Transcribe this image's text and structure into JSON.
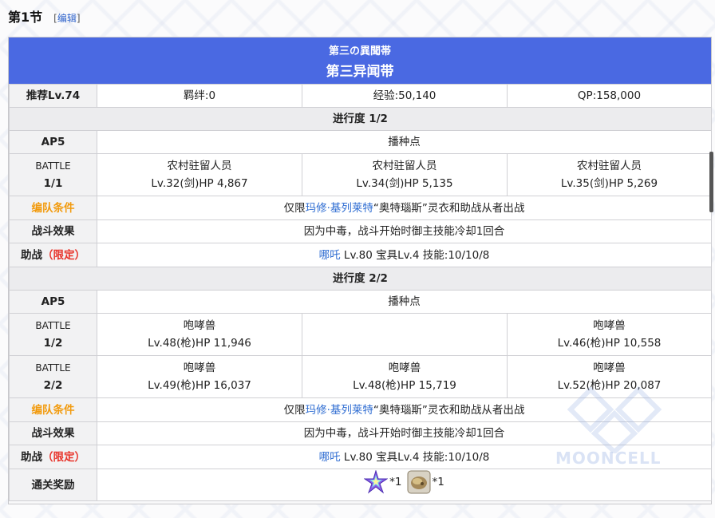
{
  "heading": {
    "title": "第1节",
    "edit_open": "[",
    "edit_label": "编辑",
    "edit_close": "]"
  },
  "banner": {
    "subtitle": "第三の異聞帯",
    "title": "第三异闻带"
  },
  "summary": {
    "level": "推荐Lv.74",
    "bond": "羁绊:0",
    "exp": "经验:50,140",
    "qp": "QP:158,000"
  },
  "progress": [
    {
      "header": "进行度 1/2",
      "ap": "AP5",
      "ap_value": "播种点",
      "battles": [
        {
          "label": "BATTLE",
          "count": "1/1",
          "enemies": [
            {
              "name": "农村驻留人员",
              "stats": "Lv.32(剑)HP 4,867"
            },
            {
              "name": "农村驻留人员",
              "stats": "Lv.34(剑)HP 5,135"
            },
            {
              "name": "农村驻留人员",
              "stats": "Lv.35(剑)HP 5,269"
            }
          ]
        }
      ],
      "formation_label": "编队条件",
      "formation_pre": "仅限",
      "formation_link": "玛修·基列莱特",
      "formation_post": "“奥特瑙斯”灵衣和助战从者出战",
      "effect_label": "战斗效果",
      "effect_text": "因为中毒，战斗开始时御主技能冷却1回合",
      "support_label": "助战",
      "support_tag": "（限定）",
      "support_link": "哪吒",
      "support_text": " Lv.80 宝具Lv.4 技能:10/10/8"
    },
    {
      "header": "进行度 2/2",
      "ap": "AP5",
      "ap_value": "播种点",
      "battles": [
        {
          "label": "BATTLE",
          "count": "1/2",
          "enemies": [
            {
              "name": "咆哮兽",
              "stats": "Lv.48(枪)HP 11,946"
            },
            {
              "name": "",
              "stats": ""
            },
            {
              "name": "咆哮兽",
              "stats": "Lv.46(枪)HP 10,558"
            }
          ]
        },
        {
          "label": "BATTLE",
          "count": "2/2",
          "enemies": [
            {
              "name": "咆哮兽",
              "stats": "Lv.49(枪)HP 16,037"
            },
            {
              "name": "咆哮兽",
              "stats": "Lv.48(枪)HP 15,719"
            },
            {
              "name": "咆哮兽",
              "stats": "Lv.52(枪)HP 20,087"
            }
          ]
        }
      ],
      "formation_label": "编队条件",
      "formation_pre": "仅限",
      "formation_link": "玛修·基列莱特",
      "formation_post": "“奥特瑙斯”灵衣和助战从者出战",
      "effect_label": "战斗效果",
      "effect_text": "因为中毒，战斗开始时御主技能冷却1回合",
      "support_label": "助战",
      "support_tag": "（限定）",
      "support_link": "哪吒",
      "support_text": " Lv.80 宝具Lv.4 技能:10/10/8"
    }
  ],
  "reward": {
    "label": "通关奖励",
    "items": [
      {
        "icon": "saint-quartz-icon",
        "count": "*1"
      },
      {
        "icon": "ascension-material-icon",
        "count": "*1"
      }
    ]
  },
  "watermark": "MOONCELL",
  "colors": {
    "banner": "#4a69e2",
    "orange": "#f29b0e",
    "red": "#e8332a",
    "link": "#2f6dd2"
  }
}
